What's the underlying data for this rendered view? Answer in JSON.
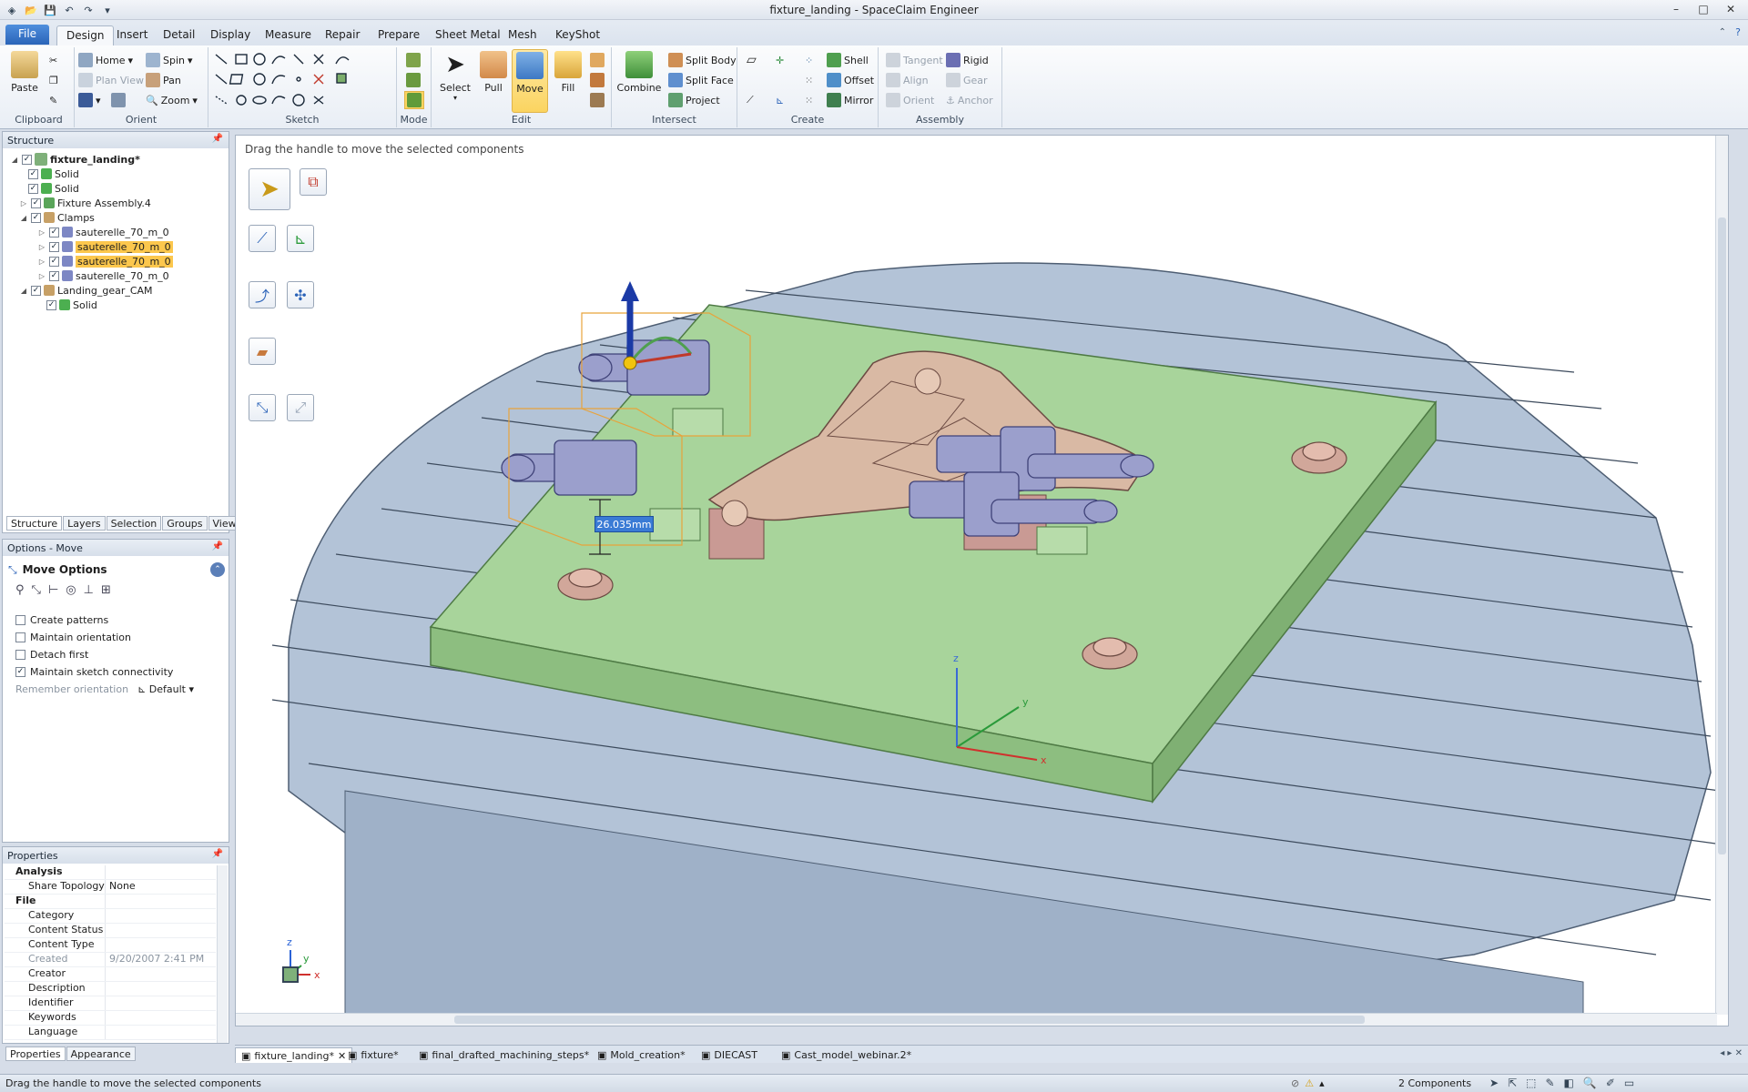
{
  "window": {
    "title": "fixture_landing - SpaceClaim Engineer"
  },
  "ribbon_tabs": [
    "File",
    "Design",
    "Insert",
    "Detail",
    "Display",
    "Measure",
    "Repair",
    "Prepare",
    "Sheet Metal",
    "Mesh",
    "KeyShot"
  ],
  "ribbon": {
    "clipboard": {
      "label": "Clipboard",
      "paste": "Paste"
    },
    "orient": {
      "label": "Orient",
      "home": "Home",
      "spin": "Spin",
      "plan_view": "Plan View",
      "pan": "Pan",
      "zoom": "Zoom"
    },
    "sketch": {
      "label": "Sketch"
    },
    "mode": {
      "label": "Mode"
    },
    "edit": {
      "label": "Edit",
      "select": "Select",
      "pull": "Pull",
      "move": "Move",
      "fill": "Fill"
    },
    "intersect": {
      "label": "Intersect",
      "combine": "Combine",
      "split_body": "Split Body",
      "split_face": "Split Face",
      "project": "Project"
    },
    "create": {
      "label": "Create",
      "shell": "Shell",
      "offset": "Offset",
      "mirror": "Mirror"
    },
    "assembly": {
      "label": "Assembly",
      "tangent": "Tangent",
      "align": "Align",
      "orient": "Orient",
      "rigid": "Rigid",
      "gear": "Gear",
      "anchor": "Anchor"
    }
  },
  "structure": {
    "title": "Structure",
    "items": [
      {
        "label": "fixture_landing*"
      },
      {
        "label": "Solid"
      },
      {
        "label": "Solid"
      },
      {
        "label": "Fixture Assembly.4"
      },
      {
        "label": "Clamps"
      },
      {
        "label": "sauterelle_70_m_0"
      },
      {
        "label": "sauterelle_70_m_0"
      },
      {
        "label": "sauterelle_70_m_0"
      },
      {
        "label": "sauterelle_70_m_0"
      },
      {
        "label": "Landing_gear_CAM"
      },
      {
        "label": "Solid"
      }
    ],
    "tabs": [
      "Structure",
      "Layers",
      "Selection",
      "Groups",
      "Views"
    ]
  },
  "options": {
    "title": "Options - Move",
    "header": "Move Options",
    "items": [
      {
        "label": "Create patterns",
        "checked": false
      },
      {
        "label": "Maintain orientation",
        "checked": false
      },
      {
        "label": "Detach first",
        "checked": false
      },
      {
        "label": "Maintain sketch connectivity",
        "checked": true
      }
    ],
    "remember_label": "Remember orientation",
    "remember_value": "Default"
  },
  "properties": {
    "title": "Properties",
    "rows": [
      {
        "k": "Analysis",
        "v": "",
        "sec": true
      },
      {
        "k": "Share Topology",
        "v": "None"
      },
      {
        "k": "File",
        "v": "",
        "sec": true
      },
      {
        "k": "Category",
        "v": ""
      },
      {
        "k": "Content Status",
        "v": ""
      },
      {
        "k": "Content Type",
        "v": ""
      },
      {
        "k": "Created",
        "v": "9/20/2007 2:41 PM",
        "dim": true
      },
      {
        "k": "Creator",
        "v": ""
      },
      {
        "k": "Description",
        "v": ""
      },
      {
        "k": "Identifier",
        "v": ""
      },
      {
        "k": "Keywords",
        "v": ""
      },
      {
        "k": "Language",
        "v": ""
      }
    ],
    "tabs": [
      "Properties",
      "Appearance"
    ]
  },
  "viewport": {
    "hint": "Drag the handle to move the selected components",
    "dimension": "26.035mm",
    "axes": {
      "x": "x",
      "y": "y",
      "z": "z"
    }
  },
  "doc_tabs": [
    "fixture_landing*",
    "fixture*",
    "final_drafted_machining_steps*",
    "Mold_creation*",
    "DIECAST",
    "Cast_model_webinar.2*"
  ],
  "status": {
    "message": "Drag the handle to move the selected components",
    "selection": "2 Components"
  },
  "colors": {
    "plate": "#9ccb8f",
    "table": "#b3c3d7",
    "clamp": "#9b9fcc",
    "part": "#d9b9a4"
  }
}
